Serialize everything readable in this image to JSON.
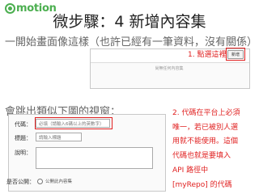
{
  "logo": {
    "text": "motion",
    "mark": "co"
  },
  "title": "微步驟：4 新增內容集",
  "subtitle_1": "一開始畫面像這樣（也許已經有一筆資料，沒有關係）",
  "list": {
    "empty_text": "尚無任何內容集",
    "add_button_label": "新增"
  },
  "callout_1": "1. 點選這裡",
  "subtitle_2": "會跳出類似下圖的視窗：",
  "form": {
    "code_label": "代碼：",
    "code_placeholder": "必填（請輸入6碼以上的英數字）",
    "title_label": "標題：",
    "title_placeholder": "請輸入標題",
    "desc_label": "說明：",
    "public_label": "是否公開：",
    "public_option": "公開此內容集"
  },
  "callout_2": {
    "lines": [
      "2. 代碼在平台上必須",
      "唯一，若已被別人選",
      "用就不能使用。這個",
      "代碼也就是要填入",
      "API 路徑中",
      "[myRepo] 的代碼"
    ]
  },
  "colors": {
    "accent": "#4caf50",
    "highlight": "#e02020"
  }
}
